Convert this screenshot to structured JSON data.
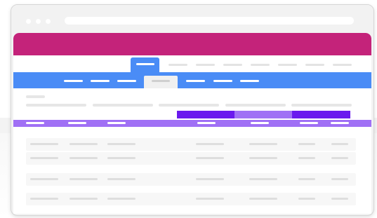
{
  "window": {
    "traffic_lights": [
      "close-dot",
      "minimize-dot",
      "maximize-dot"
    ],
    "address": ""
  },
  "colors": {
    "hero": "#c4237a",
    "nav_accent": "#4a8cf6",
    "group_header_dark": "#6a19ee",
    "group_header_light": "#a070f5",
    "column_header": "#a070f5",
    "placeholder_text": "#dedede"
  },
  "top_nav": {
    "items": [
      "",
      "",
      "",
      "",
      "",
      "",
      "",
      "",
      ""
    ],
    "active_index": 0
  },
  "sub_nav": {
    "items": [
      "",
      "",
      "",
      "",
      "",
      "",
      ""
    ],
    "active_index": 3
  },
  "toolbar": {
    "label": "",
    "filters": [
      "",
      "",
      "",
      "",
      ""
    ]
  },
  "table": {
    "group_headers": [
      "",
      "",
      ""
    ],
    "columns": [
      "",
      "",
      "",
      "",
      "",
      "",
      "",
      ""
    ],
    "rows": [
      [
        "",
        "",
        "",
        "",
        "",
        "",
        ""
      ],
      [
        "",
        "",
        "",
        "",
        "",
        "",
        ""
      ],
      [
        "",
        "",
        "",
        "",
        "",
        "",
        ""
      ],
      [
        "",
        "",
        "",
        "",
        "",
        "",
        ""
      ]
    ]
  }
}
